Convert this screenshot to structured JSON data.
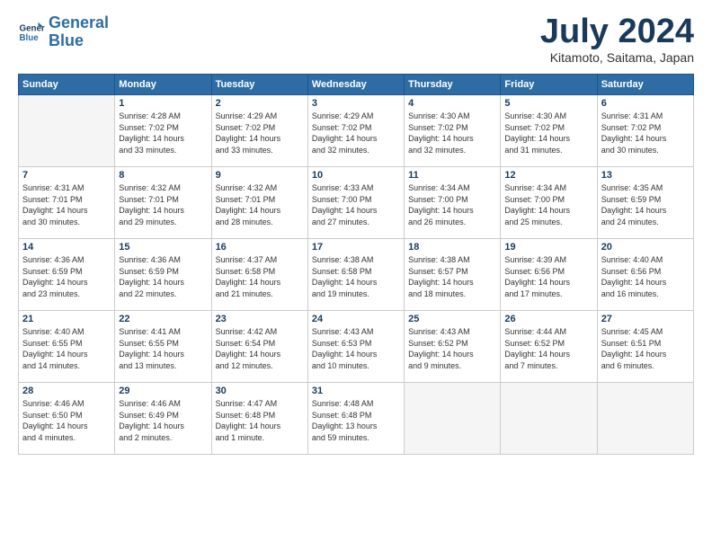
{
  "logo": {
    "line1": "General",
    "line2": "Blue"
  },
  "title": "July 2024",
  "subtitle": "Kitamoto, Saitama, Japan",
  "days_header": [
    "Sunday",
    "Monday",
    "Tuesday",
    "Wednesday",
    "Thursday",
    "Friday",
    "Saturday"
  ],
  "weeks": [
    [
      {
        "day": "",
        "info": ""
      },
      {
        "day": "1",
        "info": "Sunrise: 4:28 AM\nSunset: 7:02 PM\nDaylight: 14 hours\nand 33 minutes."
      },
      {
        "day": "2",
        "info": "Sunrise: 4:29 AM\nSunset: 7:02 PM\nDaylight: 14 hours\nand 33 minutes."
      },
      {
        "day": "3",
        "info": "Sunrise: 4:29 AM\nSunset: 7:02 PM\nDaylight: 14 hours\nand 32 minutes."
      },
      {
        "day": "4",
        "info": "Sunrise: 4:30 AM\nSunset: 7:02 PM\nDaylight: 14 hours\nand 32 minutes."
      },
      {
        "day": "5",
        "info": "Sunrise: 4:30 AM\nSunset: 7:02 PM\nDaylight: 14 hours\nand 31 minutes."
      },
      {
        "day": "6",
        "info": "Sunrise: 4:31 AM\nSunset: 7:02 PM\nDaylight: 14 hours\nand 30 minutes."
      }
    ],
    [
      {
        "day": "7",
        "info": "Sunrise: 4:31 AM\nSunset: 7:01 PM\nDaylight: 14 hours\nand 30 minutes."
      },
      {
        "day": "8",
        "info": "Sunrise: 4:32 AM\nSunset: 7:01 PM\nDaylight: 14 hours\nand 29 minutes."
      },
      {
        "day": "9",
        "info": "Sunrise: 4:32 AM\nSunset: 7:01 PM\nDaylight: 14 hours\nand 28 minutes."
      },
      {
        "day": "10",
        "info": "Sunrise: 4:33 AM\nSunset: 7:00 PM\nDaylight: 14 hours\nand 27 minutes."
      },
      {
        "day": "11",
        "info": "Sunrise: 4:34 AM\nSunset: 7:00 PM\nDaylight: 14 hours\nand 26 minutes."
      },
      {
        "day": "12",
        "info": "Sunrise: 4:34 AM\nSunset: 7:00 PM\nDaylight: 14 hours\nand 25 minutes."
      },
      {
        "day": "13",
        "info": "Sunrise: 4:35 AM\nSunset: 6:59 PM\nDaylight: 14 hours\nand 24 minutes."
      }
    ],
    [
      {
        "day": "14",
        "info": "Sunrise: 4:36 AM\nSunset: 6:59 PM\nDaylight: 14 hours\nand 23 minutes."
      },
      {
        "day": "15",
        "info": "Sunrise: 4:36 AM\nSunset: 6:59 PM\nDaylight: 14 hours\nand 22 minutes."
      },
      {
        "day": "16",
        "info": "Sunrise: 4:37 AM\nSunset: 6:58 PM\nDaylight: 14 hours\nand 21 minutes."
      },
      {
        "day": "17",
        "info": "Sunrise: 4:38 AM\nSunset: 6:58 PM\nDaylight: 14 hours\nand 19 minutes."
      },
      {
        "day": "18",
        "info": "Sunrise: 4:38 AM\nSunset: 6:57 PM\nDaylight: 14 hours\nand 18 minutes."
      },
      {
        "day": "19",
        "info": "Sunrise: 4:39 AM\nSunset: 6:56 PM\nDaylight: 14 hours\nand 17 minutes."
      },
      {
        "day": "20",
        "info": "Sunrise: 4:40 AM\nSunset: 6:56 PM\nDaylight: 14 hours\nand 16 minutes."
      }
    ],
    [
      {
        "day": "21",
        "info": "Sunrise: 4:40 AM\nSunset: 6:55 PM\nDaylight: 14 hours\nand 14 minutes."
      },
      {
        "day": "22",
        "info": "Sunrise: 4:41 AM\nSunset: 6:55 PM\nDaylight: 14 hours\nand 13 minutes."
      },
      {
        "day": "23",
        "info": "Sunrise: 4:42 AM\nSunset: 6:54 PM\nDaylight: 14 hours\nand 12 minutes."
      },
      {
        "day": "24",
        "info": "Sunrise: 4:43 AM\nSunset: 6:53 PM\nDaylight: 14 hours\nand 10 minutes."
      },
      {
        "day": "25",
        "info": "Sunrise: 4:43 AM\nSunset: 6:52 PM\nDaylight: 14 hours\nand 9 minutes."
      },
      {
        "day": "26",
        "info": "Sunrise: 4:44 AM\nSunset: 6:52 PM\nDaylight: 14 hours\nand 7 minutes."
      },
      {
        "day": "27",
        "info": "Sunrise: 4:45 AM\nSunset: 6:51 PM\nDaylight: 14 hours\nand 6 minutes."
      }
    ],
    [
      {
        "day": "28",
        "info": "Sunrise: 4:46 AM\nSunset: 6:50 PM\nDaylight: 14 hours\nand 4 minutes."
      },
      {
        "day": "29",
        "info": "Sunrise: 4:46 AM\nSunset: 6:49 PM\nDaylight: 14 hours\nand 2 minutes."
      },
      {
        "day": "30",
        "info": "Sunrise: 4:47 AM\nSunset: 6:48 PM\nDaylight: 14 hours\nand 1 minute."
      },
      {
        "day": "31",
        "info": "Sunrise: 4:48 AM\nSunset: 6:48 PM\nDaylight: 13 hours\nand 59 minutes."
      },
      {
        "day": "",
        "info": ""
      },
      {
        "day": "",
        "info": ""
      },
      {
        "day": "",
        "info": ""
      }
    ]
  ]
}
